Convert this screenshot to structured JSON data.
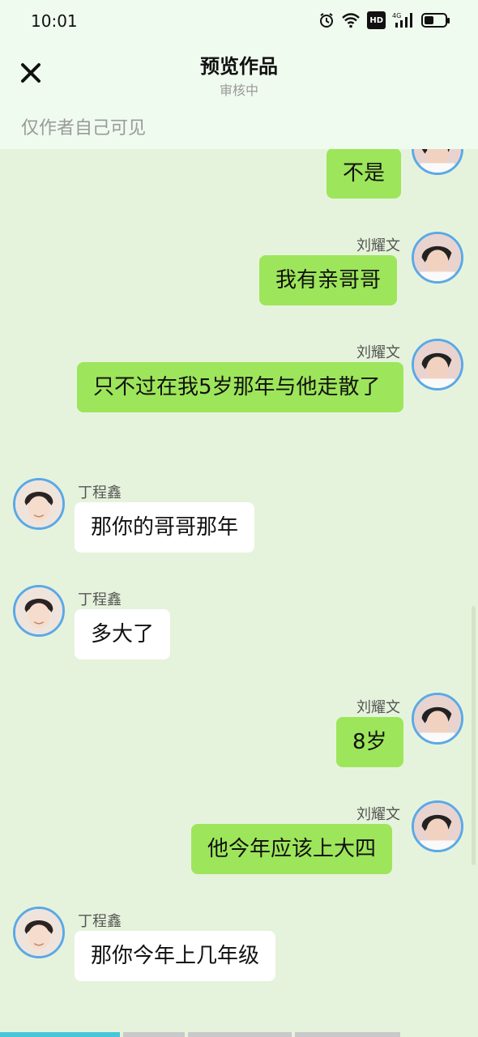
{
  "status": {
    "time": "10:01",
    "hd": "HD",
    "network": "4G",
    "battery_level": 0.45
  },
  "header": {
    "title": "预览作品",
    "subtitle": "审核中",
    "visibility": "仅作者自己可见"
  },
  "messages": [
    {
      "side": "right",
      "name": "",
      "text": "不是"
    },
    {
      "side": "right",
      "name": "刘耀文",
      "text": "我有亲哥哥"
    },
    {
      "side": "right",
      "name": "刘耀文",
      "text": "只不过在我5岁那年与他走散了"
    },
    {
      "side": "left",
      "name": "丁程鑫",
      "text": "那你的哥哥那年"
    },
    {
      "side": "left",
      "name": "丁程鑫",
      "text": "多大了"
    },
    {
      "side": "right",
      "name": "刘耀文",
      "text": "8岁"
    },
    {
      "side": "right",
      "name": "刘耀文",
      "text": "他今年应该上大四"
    },
    {
      "side": "left",
      "name": "丁程鑫",
      "text": "那你今年上几年级"
    }
  ],
  "colors": {
    "background": "#e6f3dc",
    "right_bubble": "#9de55a",
    "left_bubble": "#ffffff",
    "avatar_ring": "#5aa9e6",
    "progress_active": "#46c7d8"
  },
  "icons": {
    "close": "close-icon",
    "alarm": "alarm-icon",
    "wifi": "wifi-icon",
    "signal": "signal-icon",
    "battery": "battery-icon"
  },
  "progress": {
    "segments": 4,
    "active_index": 0
  }
}
